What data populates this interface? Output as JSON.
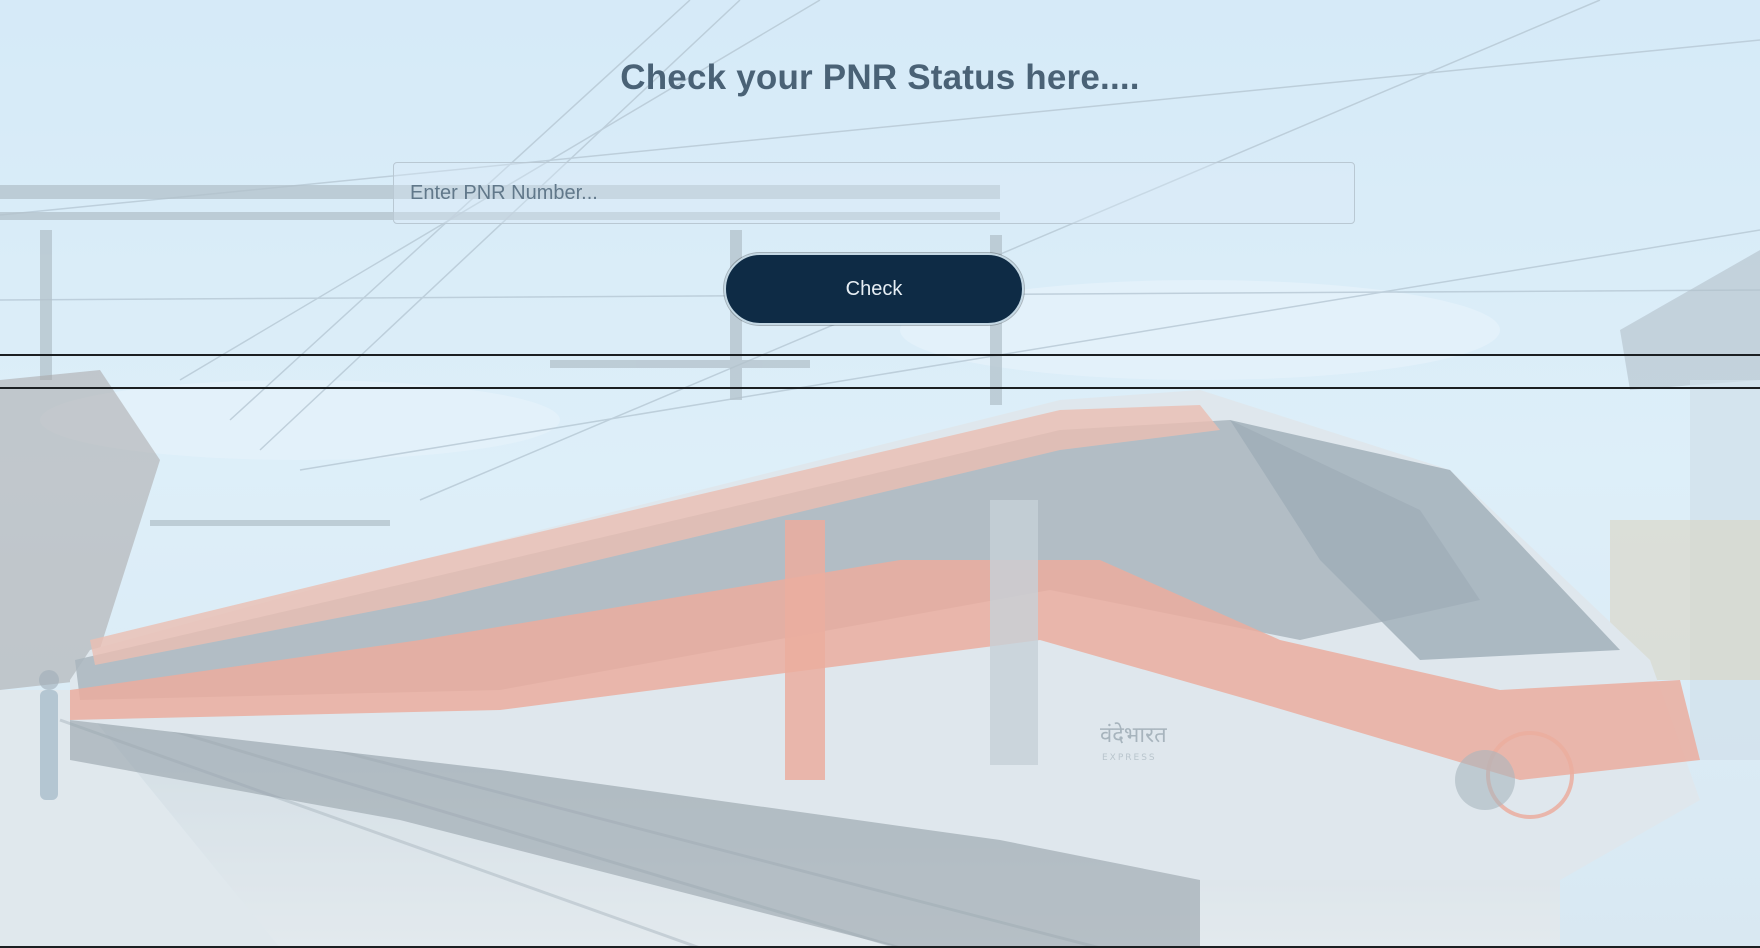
{
  "page": {
    "title": "Check your PNR Status here....",
    "pnr_input": {
      "value": "",
      "placeholder": "Enter PNR Number..."
    },
    "check_button": "Check"
  },
  "background": {
    "logo_text": "वंदेभारत",
    "logo_subtext": "EXPRESS"
  },
  "colors": {
    "title": "#4a6276",
    "button_bg": "#0e2b45",
    "button_text": "#e6eef4",
    "train_orange": "#f08a6e",
    "train_grey": "#8f9aa2",
    "sky": "#d3e9f7"
  }
}
